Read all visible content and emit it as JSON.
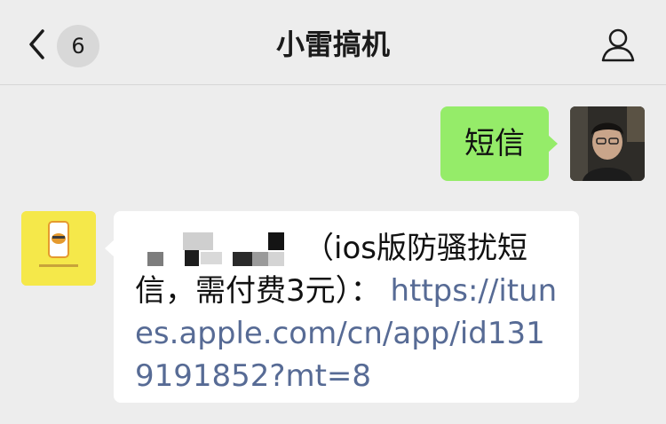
{
  "header": {
    "back_badge": "6",
    "title": "小雷搞机"
  },
  "messages": [
    {
      "sender": "me",
      "text": "短信"
    },
    {
      "sender": "bot",
      "text": "（ios版防骚扰短信，需付费3元）：",
      "link": "https://itunes.apple.com/cn/app/id1319191852?mt=8"
    }
  ],
  "colors": {
    "background": "#ededed",
    "my_bubble": "#95ec69",
    "their_bubble": "#ffffff",
    "link": "#576b95",
    "bot_avatar": "#f5e84a"
  },
  "icons": {
    "back": "chevron-left-icon",
    "profile": "person-icon"
  }
}
